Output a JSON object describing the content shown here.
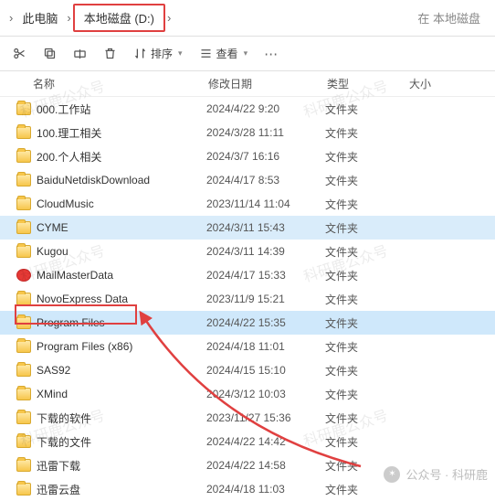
{
  "breadcrumb": {
    "root": "此电脑",
    "drive": "本地磁盘 (D:)",
    "search_hint": "在 本地磁盘"
  },
  "toolbar": {
    "sort": "排序",
    "view": "查看"
  },
  "headers": {
    "name": "名称",
    "date": "修改日期",
    "type": "类型",
    "size": "大小"
  },
  "type_folder": "文件夹",
  "files": [
    {
      "name": "000.工作站",
      "date": "2024/4/22 9:20",
      "type": "文件夹",
      "icon": "folder"
    },
    {
      "name": "100.理工相关",
      "date": "2024/3/28 11:11",
      "type": "文件夹",
      "icon": "folder"
    },
    {
      "name": "200.个人相关",
      "date": "2024/3/7 16:16",
      "type": "文件夹",
      "icon": "folder"
    },
    {
      "name": "BaiduNetdiskDownload",
      "date": "2024/4/17 8:53",
      "type": "文件夹",
      "icon": "folder"
    },
    {
      "name": "CloudMusic",
      "date": "2023/11/14 11:04",
      "type": "文件夹",
      "icon": "folder"
    },
    {
      "name": "CYME",
      "date": "2024/3/11 15:43",
      "type": "文件夹",
      "icon": "folder",
      "sel": "sel2"
    },
    {
      "name": "Kugou",
      "date": "2024/3/11 14:39",
      "type": "文件夹",
      "icon": "folder"
    },
    {
      "name": "MailMasterData",
      "date": "2024/4/17 15:33",
      "type": "文件夹",
      "icon": "mail"
    },
    {
      "name": "NovoExpress Data",
      "date": "2023/11/9 15:21",
      "type": "文件夹",
      "icon": "folder"
    },
    {
      "name": "Program Files",
      "date": "2024/4/22 15:35",
      "type": "文件夹",
      "icon": "folder",
      "sel": "sel"
    },
    {
      "name": "Program Files (x86)",
      "date": "2024/4/18 11:01",
      "type": "文件夹",
      "icon": "folder"
    },
    {
      "name": "SAS92",
      "date": "2024/4/15 15:10",
      "type": "文件夹",
      "icon": "folder"
    },
    {
      "name": "XMind",
      "date": "2024/3/12 10:03",
      "type": "文件夹",
      "icon": "folder"
    },
    {
      "name": "下载的软件",
      "date": "2023/11/27 15:36",
      "type": "文件夹",
      "icon": "folder"
    },
    {
      "name": "下载的文件",
      "date": "2024/4/22 14:42",
      "type": "文件夹",
      "icon": "folder"
    },
    {
      "name": "迅雷下载",
      "date": "2024/4/22 14:58",
      "type": "文件夹",
      "icon": "folder"
    },
    {
      "name": "迅雷云盘",
      "date": "2024/4/18 11:03",
      "type": "文件夹",
      "icon": "folder"
    }
  ],
  "watermark": "科研鹿公众号",
  "footer": "公众号 · 科研鹿"
}
